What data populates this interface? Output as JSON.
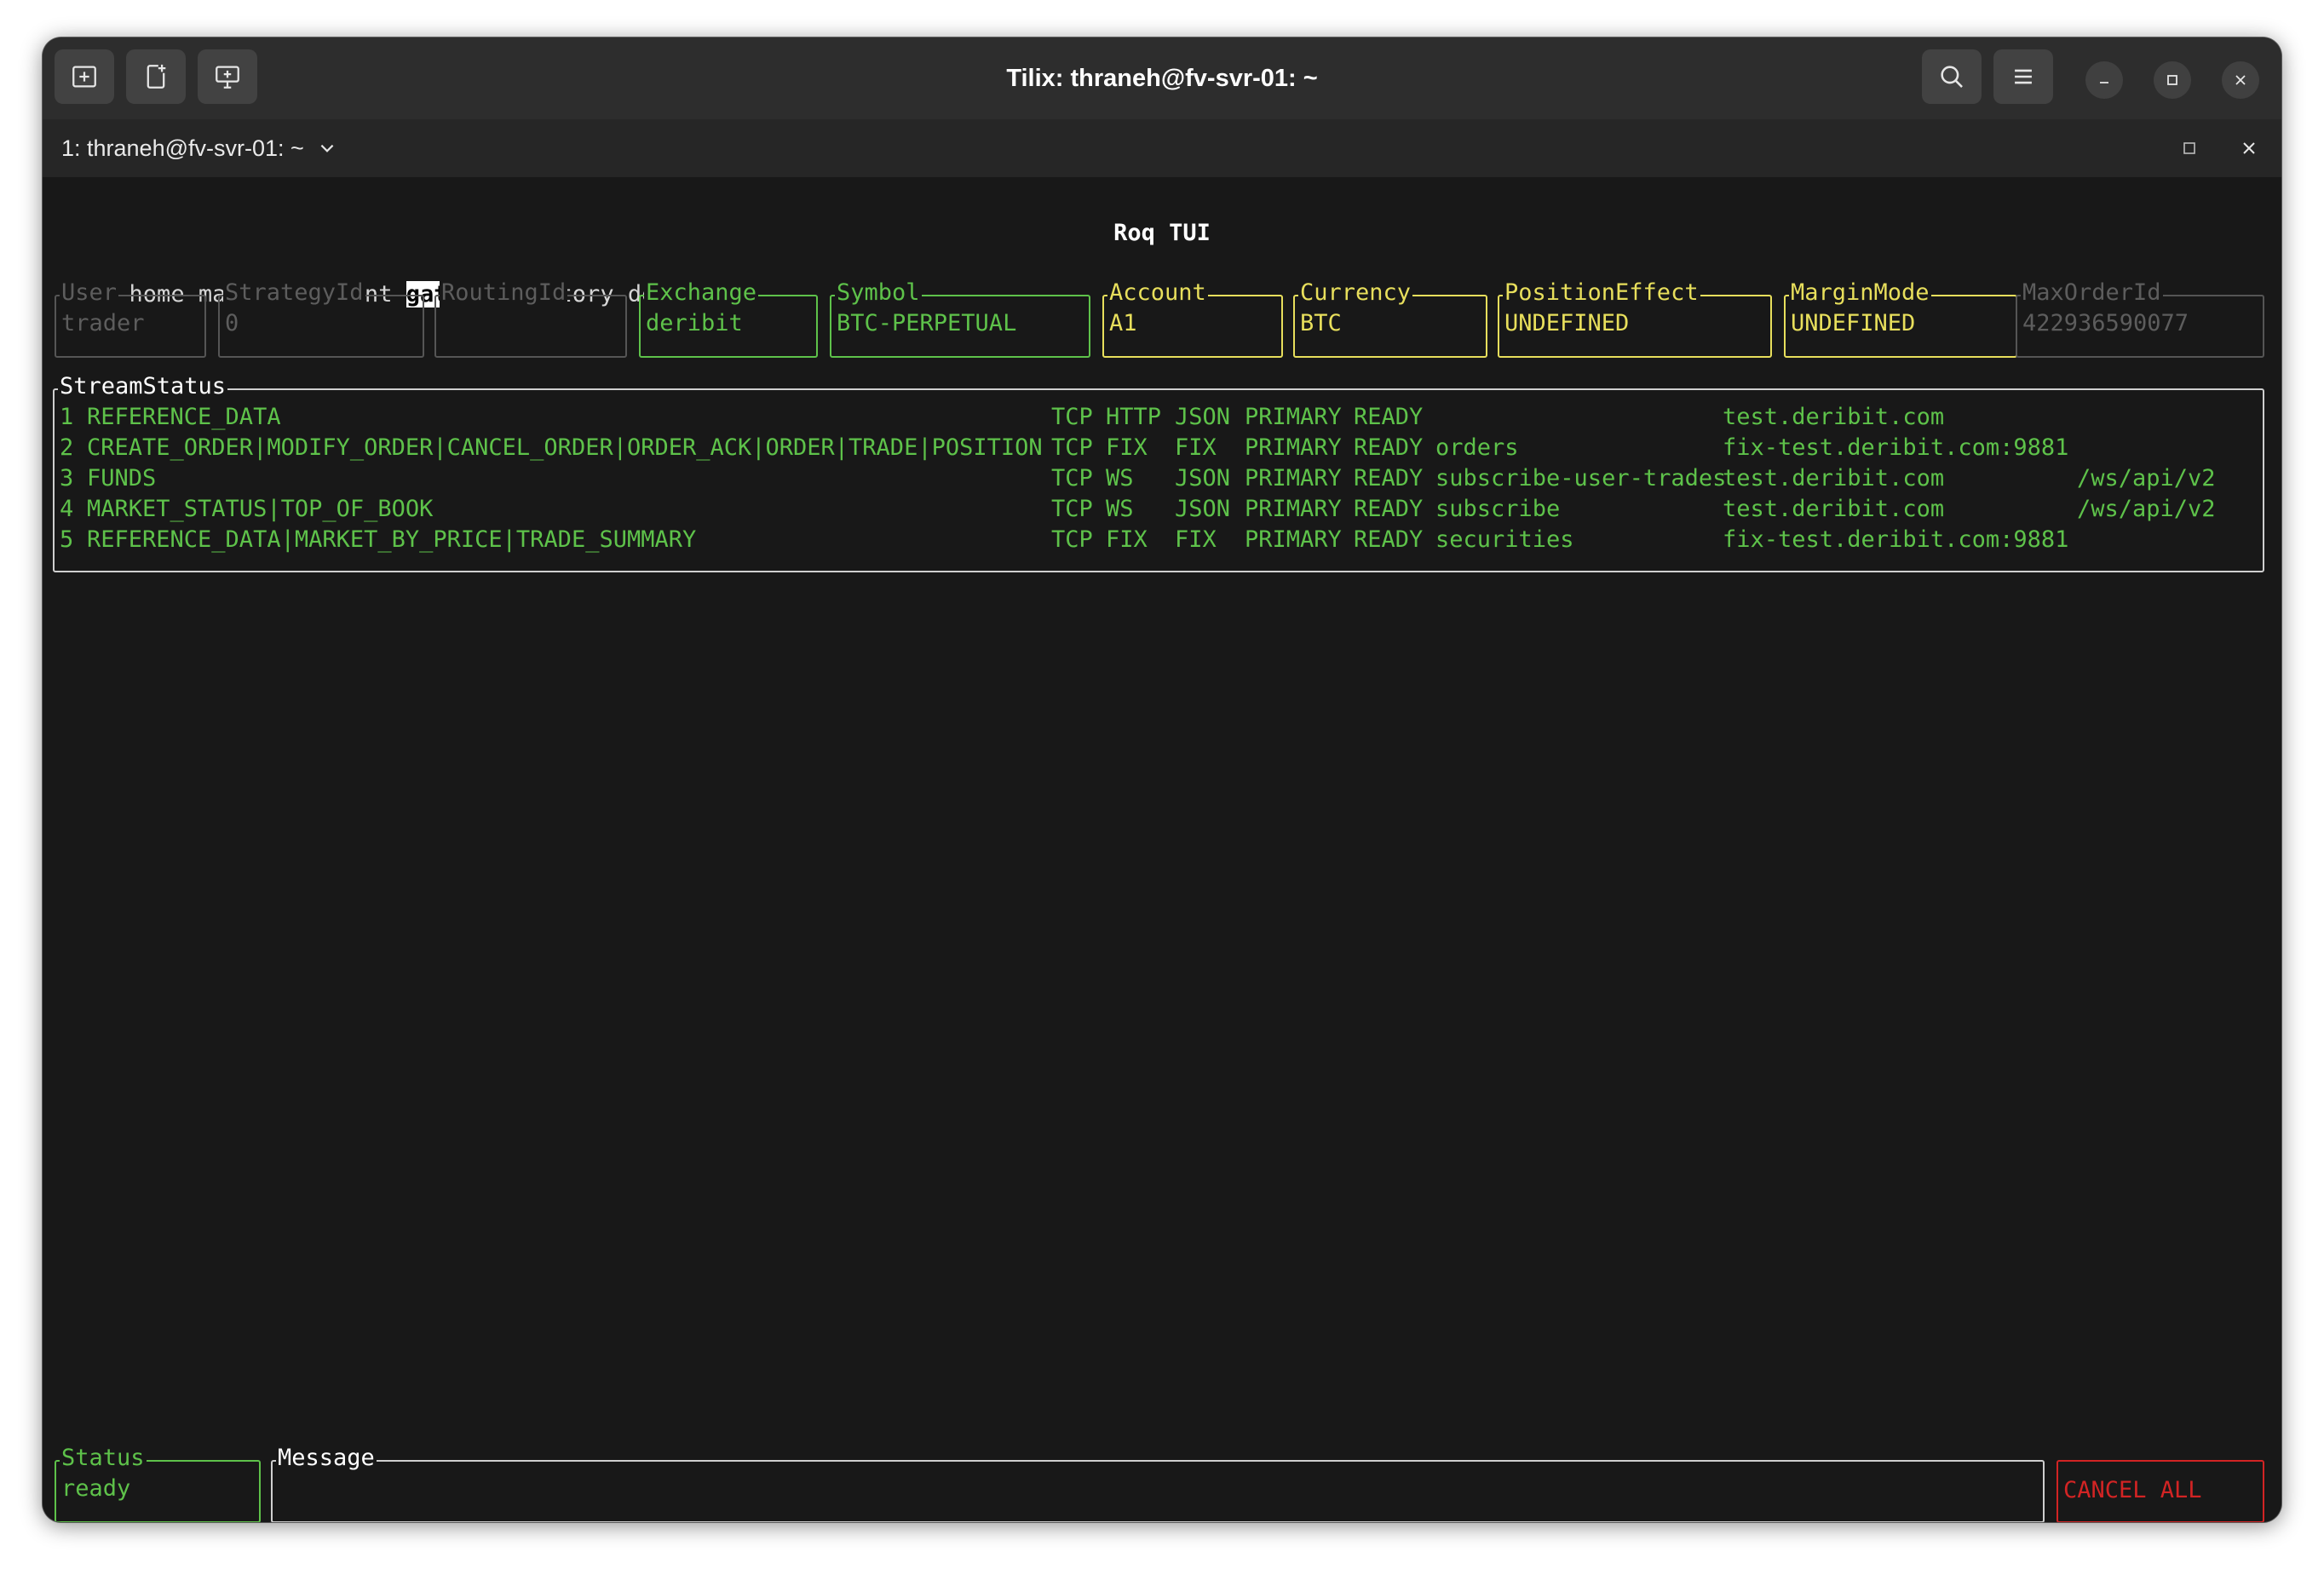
{
  "window": {
    "title": "Tilix: thraneh@fv-svr-01: ~",
    "session_label": "1: thraneh@fv-svr-01: ~"
  },
  "app": {
    "title": "Roq TUI",
    "menu": [
      "home",
      "market",
      "account",
      "gateway",
      "history",
      "debug"
    ],
    "selected_menu": "gateway"
  },
  "fields": {
    "user": {
      "label": "User",
      "value": "trader"
    },
    "strategy_id": {
      "label": "StrategyId",
      "value": "0"
    },
    "routing_id": {
      "label": "RoutingId",
      "value": ""
    },
    "exchange": {
      "label": "Exchange",
      "value": "deribit"
    },
    "symbol": {
      "label": "Symbol",
      "value": "BTC-PERPETUAL"
    },
    "account": {
      "label": "Account",
      "value": "A1"
    },
    "currency": {
      "label": "Currency",
      "value": "BTC"
    },
    "position_effect": {
      "label": "PositionEffect",
      "value": "UNDEFINED"
    },
    "margin_mode": {
      "label": "MarginMode",
      "value": "UNDEFINED"
    },
    "max_order_id": {
      "label": "MaxOrderId",
      "value": "422936590077"
    }
  },
  "stream_status": {
    "label": "StreamStatus",
    "rows": [
      {
        "id": "1",
        "supports": "REFERENCE_DATA",
        "transport": "TCP",
        "protocol": "HTTP",
        "encoding": "JSON",
        "priority": "PRIMARY",
        "state": "READY",
        "channel": "",
        "host": "test.deribit.com",
        "path": ""
      },
      {
        "id": "2",
        "supports": "CREATE_ORDER|MODIFY_ORDER|CANCEL_ORDER|ORDER_ACK|ORDER|TRADE|POSITION",
        "transport": "TCP",
        "protocol": "FIX",
        "encoding": "FIX",
        "priority": "PRIMARY",
        "state": "READY",
        "channel": "orders",
        "host": "fix-test.deribit.com:9881",
        "path": ""
      },
      {
        "id": "3",
        "supports": "FUNDS",
        "transport": "TCP",
        "protocol": "WS",
        "encoding": "JSON",
        "priority": "PRIMARY",
        "state": "READY",
        "channel": "subscribe-user-trades",
        "host": "test.deribit.com",
        "path": "/ws/api/v2"
      },
      {
        "id": "4",
        "supports": "MARKET_STATUS|TOP_OF_BOOK",
        "transport": "TCP",
        "protocol": "WS",
        "encoding": "JSON",
        "priority": "PRIMARY",
        "state": "READY",
        "channel": "subscribe",
        "host": "test.deribit.com",
        "path": "/ws/api/v2"
      },
      {
        "id": "5",
        "supports": "REFERENCE_DATA|MARKET_BY_PRICE|TRADE_SUMMARY",
        "transport": "TCP",
        "protocol": "FIX",
        "encoding": "FIX",
        "priority": "PRIMARY",
        "state": "READY",
        "channel": "securities",
        "host": "fix-test.deribit.com:9881",
        "path": ""
      }
    ]
  },
  "footer": {
    "status_label": "Status",
    "status_value": "ready",
    "message_label": "Message",
    "message_value": "",
    "cancel_all_label": "CANCEL ALL"
  },
  "colors": {
    "green": "#5ec24a",
    "yellow": "#e8df5c",
    "gray": "#5d5d5d",
    "red": "#d22424",
    "background": "#181818"
  }
}
